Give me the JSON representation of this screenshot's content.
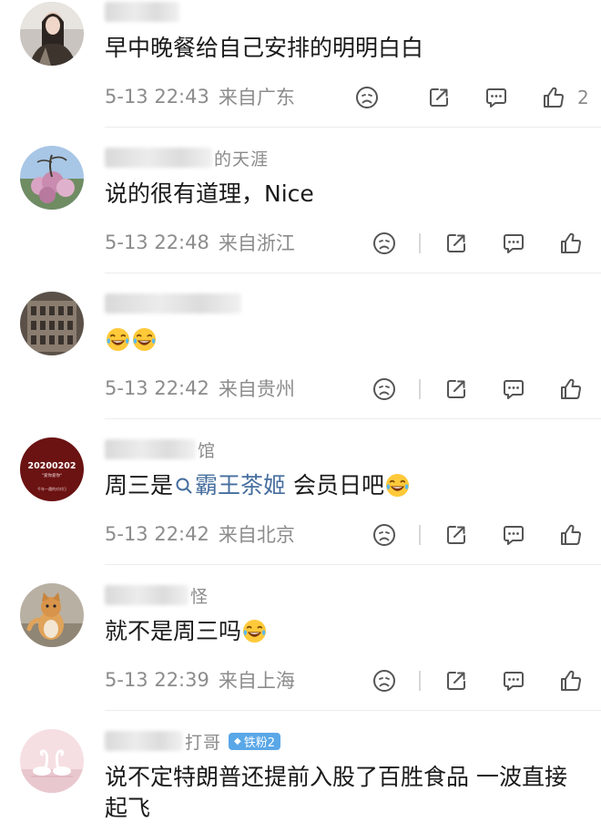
{
  "comments": [
    {
      "username_suffix": "",
      "text": "早中晚餐给自己安排的明明白白",
      "time": "5-13 22:43",
      "location": "来自广东",
      "likes": "2"
    },
    {
      "username_suffix": "的天涯",
      "text": "说的很有道理，Nice",
      "time": "5-13 22:48",
      "location": "来自浙江",
      "likes": ""
    },
    {
      "username_suffix": "",
      "text": "",
      "time": "5-13 22:42",
      "location": "来自贵州",
      "likes": ""
    },
    {
      "username_suffix": "馆",
      "text_before": "周三是",
      "topic": "霸王茶姬",
      "text_after": " 会员日吧",
      "time": "5-13 22:42",
      "location": "来自北京",
      "likes": ""
    },
    {
      "username_suffix": "怪",
      "text": "就不是周三吗",
      "time": "5-13 22:39",
      "location": "来自上海",
      "likes": ""
    },
    {
      "username_suffix": "打哥",
      "badge": "铁粉2",
      "text": "说不定特朗普还提前入股了百胜食品 一波直接起飞",
      "time": "",
      "location": "",
      "likes": ""
    }
  ],
  "icons": {
    "dislike": "frown-face-icon",
    "repost": "share-arrow-icon",
    "comment": "speech-bubble-icon",
    "like": "thumbs-up-icon",
    "emoji": "laughing-tears-emoji"
  },
  "colors": {
    "topic_link": "#466e9e",
    "meta_gray": "#8c8c8c",
    "badge_blue": "#5aa7e8"
  }
}
